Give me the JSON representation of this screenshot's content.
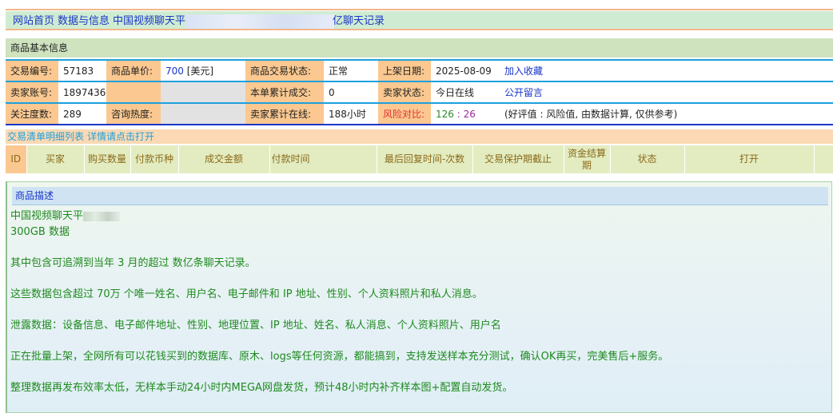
{
  "breadcrumb": {
    "home": "网站首页",
    "category": "数据与信息",
    "title_start": "中国视频聊天平",
    "title_end": "亿聊天记录"
  },
  "basic_info": {
    "section_title": "商品基本信息",
    "row1": {
      "trade_no_label": "交易编号:",
      "trade_no": "57183",
      "price_label": "商品单价:",
      "price": "700",
      "price_unit": "[美元]",
      "status_label": "商品交易状态:",
      "status": "正常",
      "listed_label": "上架日期:",
      "listed": "2025-08-09",
      "favorite": "加入收藏"
    },
    "row2": {
      "seller_label": "卖家账号:",
      "seller": "1897436",
      "deals_label": "本单累计成交:",
      "deals": "0",
      "seller_status_label": "卖家状态:",
      "seller_status": "今日在线",
      "message": "公开留言"
    },
    "row3": {
      "follow_label": "关注度数:",
      "follow": "289",
      "heat_label": "咨询热度:",
      "online_label": "卖家累计在线:",
      "online": "188小时",
      "risk_label": "风险对比:",
      "risk_good": "126",
      "risk_sep": ":",
      "risk_bad": "26",
      "risk_note": "(好评值 : 风险值, 由数据计算, 仅供参考)"
    }
  },
  "orders": {
    "link_text": "交易清单明细列表",
    "link_more": "详情请点击打开",
    "columns": [
      "ID",
      "买家",
      "购买数量",
      "付款币种",
      "成交金额",
      "付款时间",
      "最后回复时间-次数",
      "交易保护期截止",
      "资金结算期",
      "状态",
      "打开"
    ]
  },
  "description": {
    "title": "商品描述",
    "line1": "中国视频聊天平",
    "line2": "300GB 数据",
    "p1": "其中包含可追溯到当年 3 月的超过 数亿条聊天记录。",
    "p2": "这些数据包含超过 70万 个唯一姓名、用户名、电子邮件和 IP 地址、性别、个人资料照片和私人消息。",
    "p3": "泄露数据：设备信息、电子邮件地址、性别、地理位置、IP 地址、姓名、私人消息、个人资料照片、用户名",
    "p4": "正在批量上架，全网所有可以花钱买到的数据库、原木、logs等任何资源，都能搞到，支持发送样本充分测试，确认OK再买，完美售后+服务。",
    "p5": "整理数据再发布效率太低，无样本手动24小时内MEGA网盘发货，预计48小时内补齐样本图+配置自动发货。"
  }
}
